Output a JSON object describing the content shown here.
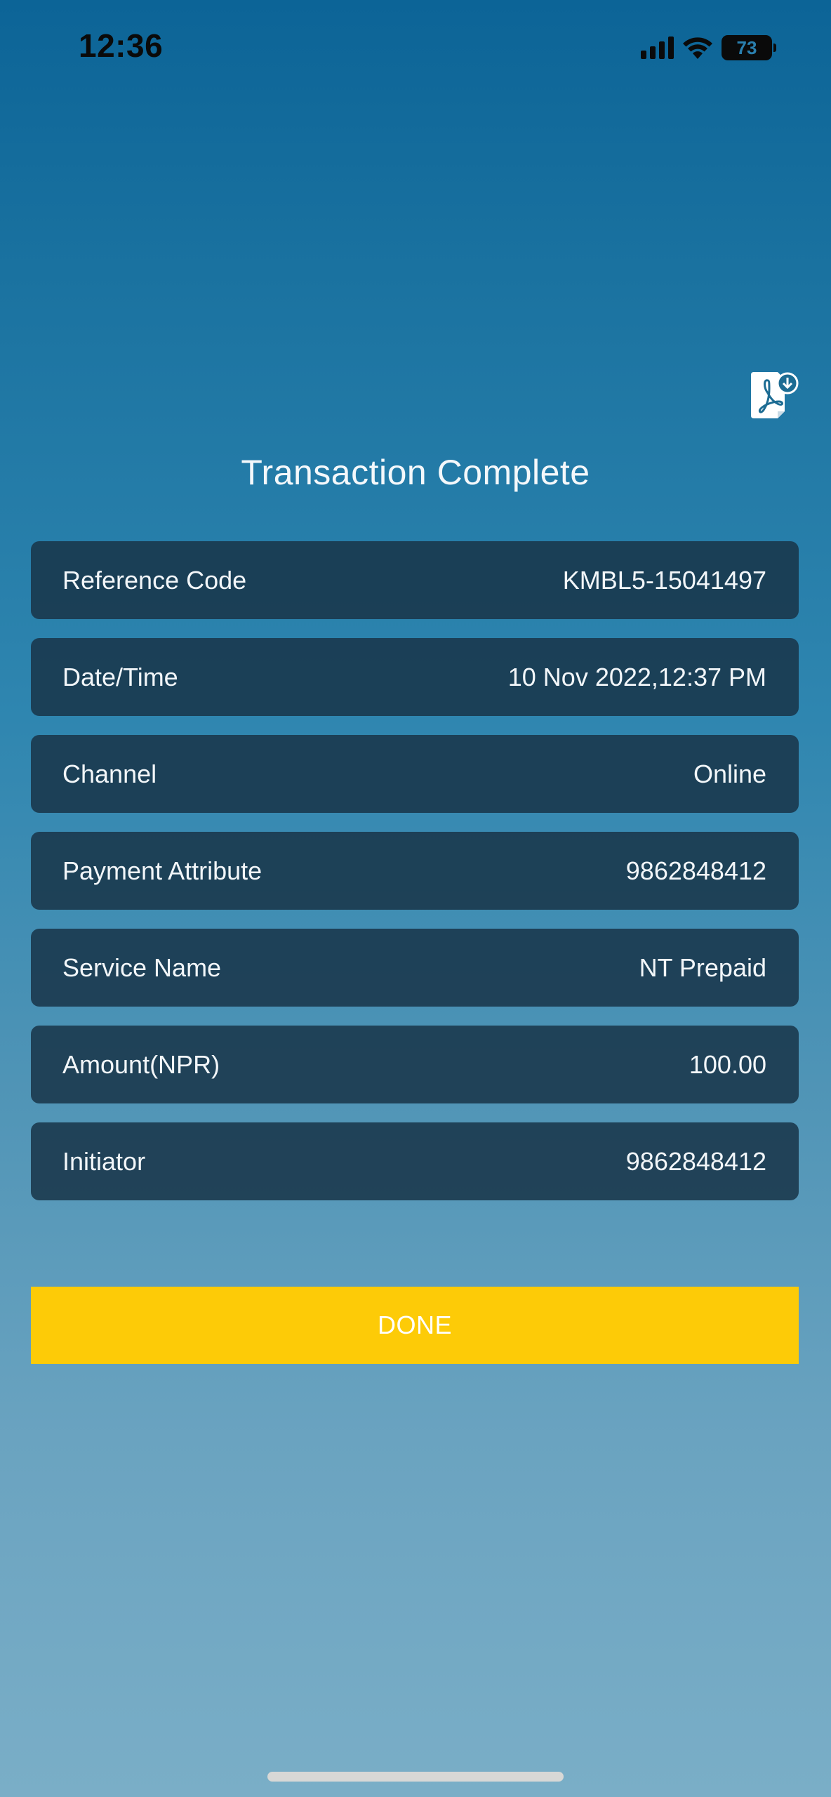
{
  "status_bar": {
    "time": "12:36",
    "battery_level": "73",
    "icons": [
      "signal-icon",
      "wifi-icon",
      "battery-icon"
    ]
  },
  "header": {
    "pdf_download_icon": "pdf-download-icon",
    "title": "Transaction Complete"
  },
  "details": [
    {
      "label": "Reference Code",
      "value": "KMBL5-15041497"
    },
    {
      "label": "Date/Time",
      "value": "10 Nov 2022,12:37 PM"
    },
    {
      "label": "Channel",
      "value": "Online"
    },
    {
      "label": "Payment Attribute",
      "value": "9862848412"
    },
    {
      "label": "Service Name",
      "value": "NT Prepaid"
    },
    {
      "label": "Amount(NPR)",
      "value": "100.00"
    },
    {
      "label": "Initiator",
      "value": "9862848412"
    }
  ],
  "actions": {
    "done_label": "DONE"
  },
  "colors": {
    "accent_button": "#fdcb07",
    "card_background": "#1b3a4f",
    "background_top": "#0c6497",
    "background_bottom": "#7aaec7"
  }
}
